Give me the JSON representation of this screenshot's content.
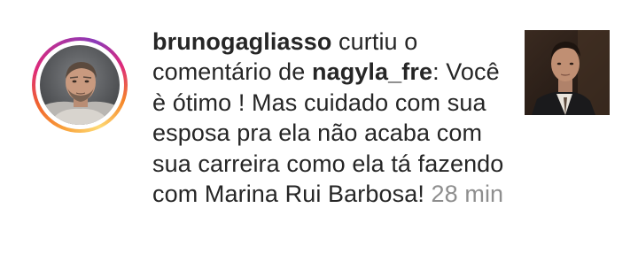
{
  "notification": {
    "actor_username": "brunogagliasso",
    "action_text_1": " curtiu o comentário de ",
    "commenter_username": "nagyla_fre",
    "colon": ":",
    "comment_text": " Você è ótimo ! Mas cuidado com sua esposa pra ela não acaba com sua carreira como ela tá fazendo com Marina Rui Barbosa!",
    "time": " 28 min"
  },
  "colors": {
    "text": "#262626",
    "timestamp": "#8e8e8e",
    "ring_gradient": [
      "#feda75",
      "#f58529",
      "#dd2a7b",
      "#8a3ab9"
    ]
  }
}
